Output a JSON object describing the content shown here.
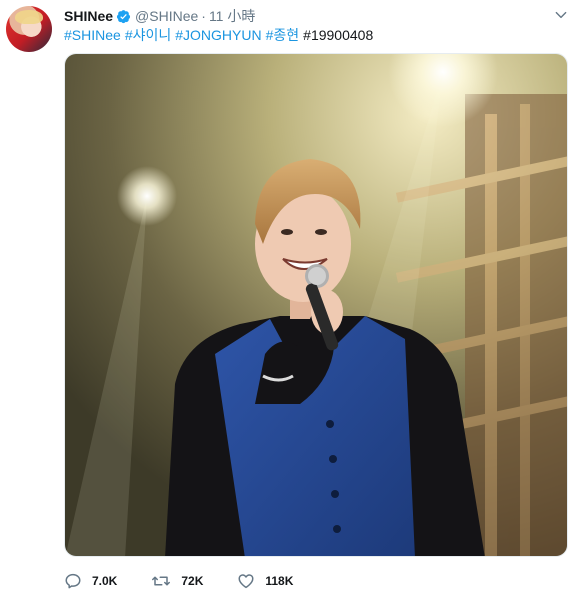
{
  "tweet": {
    "author_name": "SHINee",
    "handle": "@SHINee",
    "separator": "·",
    "time": "11 小時",
    "hashtags": [
      "#SHINee",
      "#샤이니",
      "#JONGHYUN",
      "#종현",
      "#19900408"
    ],
    "actions": {
      "replies": "7.0K",
      "retweets": "72K",
      "likes": "118K"
    }
  },
  "colors": {
    "link": "#1b95e0",
    "verified": "#1da1f2",
    "meta": "#657786"
  },
  "icons": [
    "verified-badge-icon",
    "chevron-down-icon",
    "reply-icon",
    "retweet-icon",
    "like-icon"
  ]
}
